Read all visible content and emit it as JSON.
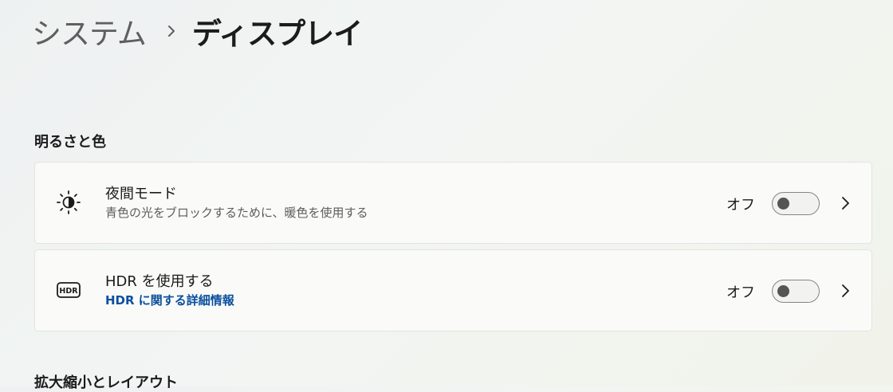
{
  "breadcrumb": {
    "parent": "システム",
    "separator_icon": "chevron-right-icon",
    "current": "ディスプレイ"
  },
  "sections": [
    {
      "title": "明るさと色"
    },
    {
      "title": "拡大縮小とレイアウト"
    }
  ],
  "settings": [
    {
      "title": "夜間モード",
      "subtitle": "青色の光をブロックするために、暖色を使用する",
      "icon": "night-mode-icon",
      "state_label": "オフ",
      "toggle_on": false
    },
    {
      "title": "HDR を使用する",
      "link": "HDR に関する詳細情報",
      "icon": "hdr-icon",
      "state_label": "オフ",
      "toggle_on": false
    }
  ],
  "colors": {
    "link": "#0a4f9e",
    "card_background": "#fafaf8",
    "card_border": "#e3e4e1"
  }
}
